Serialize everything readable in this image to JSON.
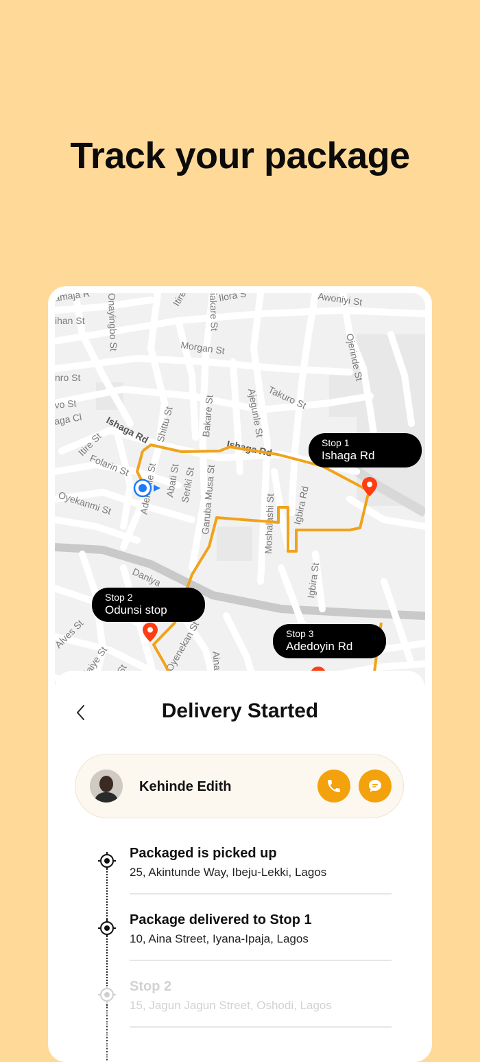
{
  "headline": "Track your package",
  "colors": {
    "background": "#FFD998",
    "accent": "#F3A10C",
    "route": "#F0A21A",
    "pin": "#FF3D12",
    "current_location": "#1E7BF5"
  },
  "map": {
    "street_labels": [
      "amaja R",
      "ihan St",
      "Onayingbo St",
      "Itire",
      "iakare St",
      "Ilora S",
      "Awoniyi St",
      "Morgan St",
      "Ojerinde St",
      "nro St",
      "vo St",
      "aga Cl",
      "Takuro St",
      "Ishaga Rd",
      "Shittu St",
      "Bakare St",
      "Ajegunle St",
      "Itire St",
      "Folarin St",
      "Ishaga Rd",
      "Adekunle St",
      "Abati St",
      "Seriki St",
      "Oyekanmi St",
      "Garuba Musa St",
      "Moshalashi St",
      "Igbira Rd",
      "Igbira St",
      "Daniya",
      "Alves St",
      "Ijaiye St",
      "i St",
      "Oyenekan St",
      "Aina"
    ],
    "stops": [
      {
        "label": "Stop 1",
        "road": "Ishaga Rd"
      },
      {
        "label": "Stop 2",
        "road": "Odunsi stop"
      },
      {
        "label": "Stop 3",
        "road": "Adedoyin Rd"
      }
    ],
    "icons": {
      "pin": "location-pin-icon",
      "current": "current-location-icon"
    }
  },
  "sheet": {
    "title": "Delivery Started",
    "back_icon": "chevron-left-icon",
    "driver": {
      "name": "Kehinde Edith",
      "call_icon": "phone-icon",
      "message_icon": "chat-bubble-icon"
    },
    "timeline": [
      {
        "title": "Packaged is picked up",
        "address": "25, Akintunde Way, Ibeju-Lekki, Lagos",
        "done": true
      },
      {
        "title": "Package delivered to Stop 1",
        "address": "10, Aina Street, Iyana-Ipaja, Lagos",
        "done": true
      },
      {
        "title": "Stop 2",
        "address": "15, Jagun Jagun Street, Oshodi, Lagos",
        "done": false
      }
    ]
  }
}
